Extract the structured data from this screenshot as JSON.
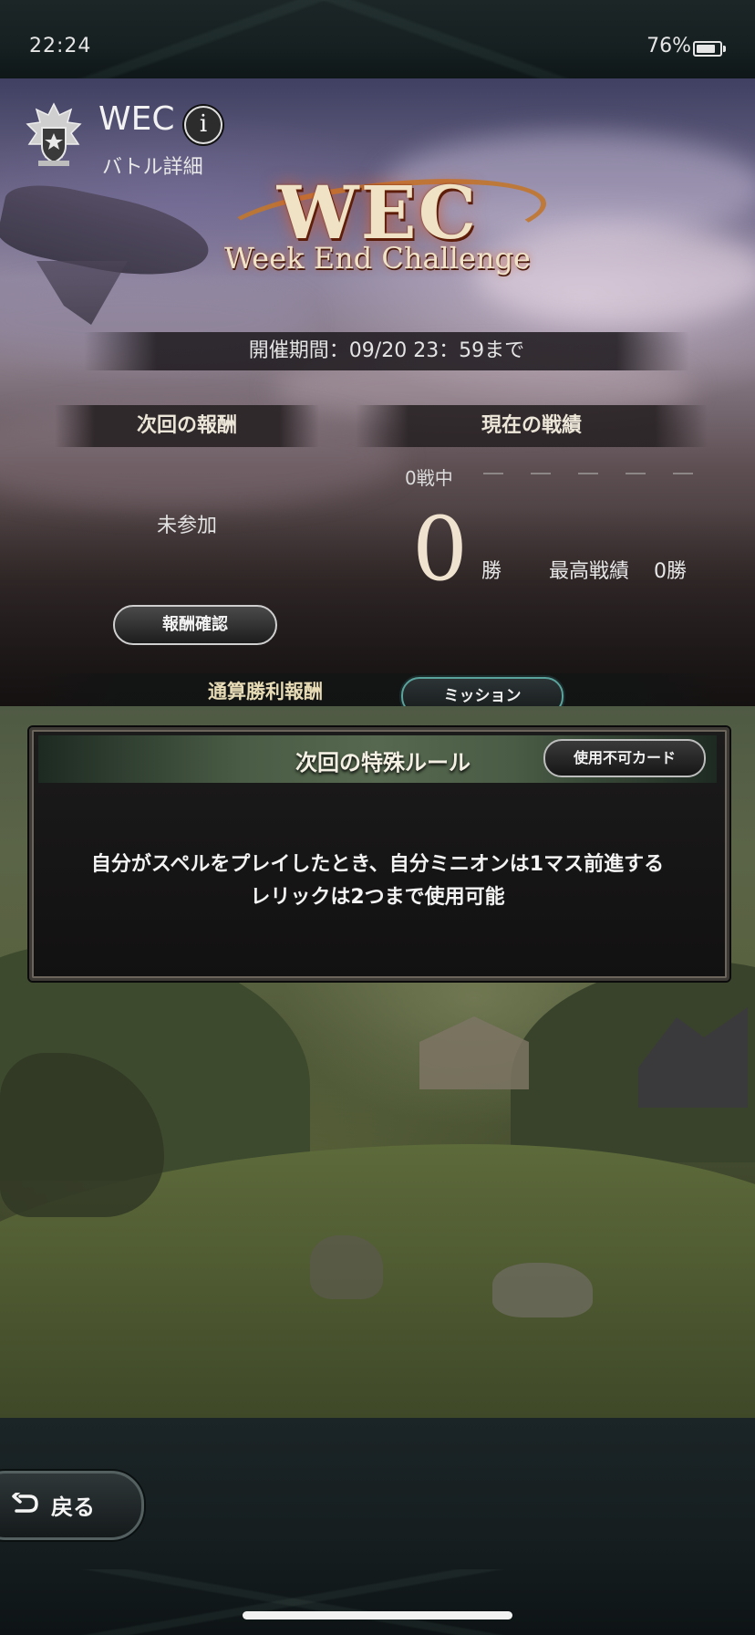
{
  "status_bar": {
    "time": "22:24",
    "battery": "76%"
  },
  "header": {
    "title": "WEC",
    "subtitle": "バトル詳細",
    "info_icon": "i"
  },
  "logo": {
    "main": "WEC",
    "tagline": "Week End Challenge"
  },
  "period": "開催期間：09/20 23：59まで",
  "next_reward": {
    "heading": "次回の報酬",
    "status": "未参加",
    "confirm_button": "報酬確認"
  },
  "current_record": {
    "heading": "現在の戦績",
    "battle_count": "0戦中",
    "wins": "0",
    "wins_unit": "勝",
    "best_label": "最高戦績",
    "best_value": "0勝"
  },
  "tabs": {
    "total_wins": "通算勝利報酬",
    "mission": "ミッション"
  },
  "rule_panel": {
    "title": "次回の特殊ルール",
    "unusable_button": "使用不可カード",
    "lines": [
      "自分がスペルをプレイしたとき、自分ミニオンは1マス前進する",
      "レリックは2つまで使用可能"
    ]
  },
  "footer": {
    "back_label": "戻る",
    "back_icon": "return-arrow-icon"
  }
}
